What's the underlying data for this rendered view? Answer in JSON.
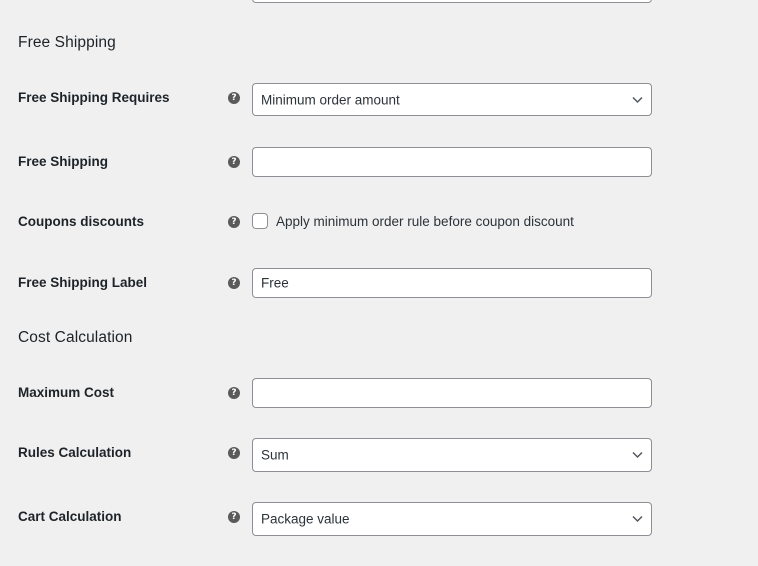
{
  "sections": {
    "free_shipping": {
      "title": "Free Shipping",
      "rows": {
        "requires": {
          "label": "Free Shipping Requires",
          "type": "select",
          "value": "Minimum order amount"
        },
        "amount": {
          "label": "Free Shipping",
          "type": "text",
          "value": ""
        },
        "coupons": {
          "label": "Coupons discounts",
          "type": "checkbox",
          "checked": false,
          "checkbox_label": "Apply minimum order rule before coupon discount"
        },
        "label": {
          "label": "Free Shipping Label",
          "type": "text",
          "value": "Free"
        }
      }
    },
    "cost_calculation": {
      "title": "Cost Calculation",
      "rows": {
        "max_cost": {
          "label": "Maximum Cost",
          "type": "text",
          "value": ""
        },
        "rules_calc": {
          "label": "Rules Calculation",
          "type": "select",
          "value": "Sum"
        },
        "cart_calc": {
          "label": "Cart Calculation",
          "type": "select",
          "value": "Package value"
        }
      }
    }
  },
  "icons": {
    "help": "?",
    "help_name": "help-tooltip-icon",
    "select_arrow": "chevron-down-icon"
  },
  "colors": {
    "background": "#f0f0f1",
    "text": "#1d2327",
    "field_border": "#8c8f94",
    "help_icon": "#5a5a5a"
  }
}
